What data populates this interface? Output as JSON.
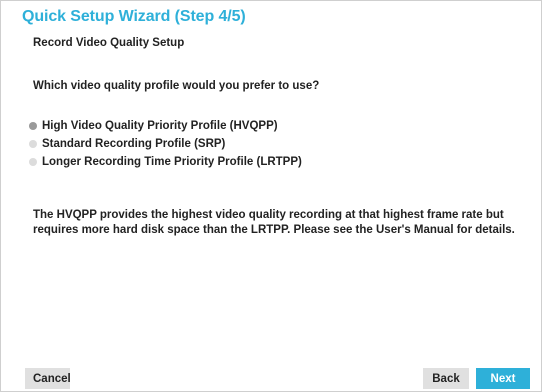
{
  "wizard": {
    "title": "Quick Setup Wizard (Step 4/5)",
    "subtitle": "Record Video Quality Setup",
    "question": "Which video quality profile would you prefer to use?",
    "options": [
      {
        "label": "High Video Quality Priority Profile (HVQPP)",
        "selected": true
      },
      {
        "label": "Standard Recording Profile (SRP)",
        "selected": false
      },
      {
        "label": "Longer Recording Time Priority Profile (LRTPP)",
        "selected": false
      }
    ],
    "description": "The HVQPP provides the highest video quality recording at that highest frame rate but requires more hard disk space than the LRTPP. Please see the User's Manual for details."
  },
  "buttons": {
    "cancel": "Cancel",
    "back": "Back",
    "next": "Next"
  },
  "colors": {
    "accent": "#2eb0d9",
    "radio_selected": "#9a9a9a",
    "radio_unselected": "#dcdcdc",
    "button_gray": "#e0e0e0"
  }
}
